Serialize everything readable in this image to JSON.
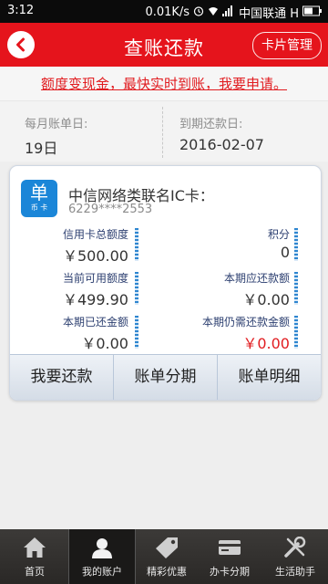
{
  "status_bar": {
    "time": "3:12",
    "speed": "0.01K/s",
    "carrier": "中国联通 H",
    "battery": ""
  },
  "header": {
    "title": "查账还款",
    "card_manage_label": "卡片管理"
  },
  "promo": {
    "text": "额度变现金，最快实时到账，我要申请。"
  },
  "dates": {
    "statement_label": "每月账单日:",
    "statement_value": "19日",
    "due_label": "到期还款日:",
    "due_value": "2016-02-07"
  },
  "card": {
    "logo_big": "单",
    "logo_small": "币 卡",
    "name": "中信网络类联名IC卡：",
    "number": "6229****2553",
    "metrics": {
      "total_limit": {
        "label": "信用卡总额度",
        "value": "￥500.00"
      },
      "points": {
        "label": "积分",
        "value": "0"
      },
      "available_limit": {
        "label": "当前可用额度",
        "value": "￥499.90"
      },
      "period_due": {
        "label": "本期应还款额",
        "value": "￥0.00"
      },
      "period_paid": {
        "label": "本期已还金额",
        "value": "￥0.00"
      },
      "remaining_due": {
        "label": "本期仍需还款金额",
        "value": "￥0.00"
      }
    },
    "buttons": {
      "repay": "我要还款",
      "installment": "账单分期",
      "details": "账单明细"
    }
  },
  "tabs": [
    {
      "label": "首页",
      "icon": "home-icon"
    },
    {
      "label": "我的账户",
      "icon": "user-icon"
    },
    {
      "label": "精彩优惠",
      "icon": "tag-icon"
    },
    {
      "label": "办卡分期",
      "icon": "card-icon"
    },
    {
      "label": "生活助手",
      "icon": "tools-icon"
    }
  ],
  "colors": {
    "brand_red": "#e5141c",
    "promo_red": "#e11c20",
    "logo_blue": "#1b86d8"
  }
}
